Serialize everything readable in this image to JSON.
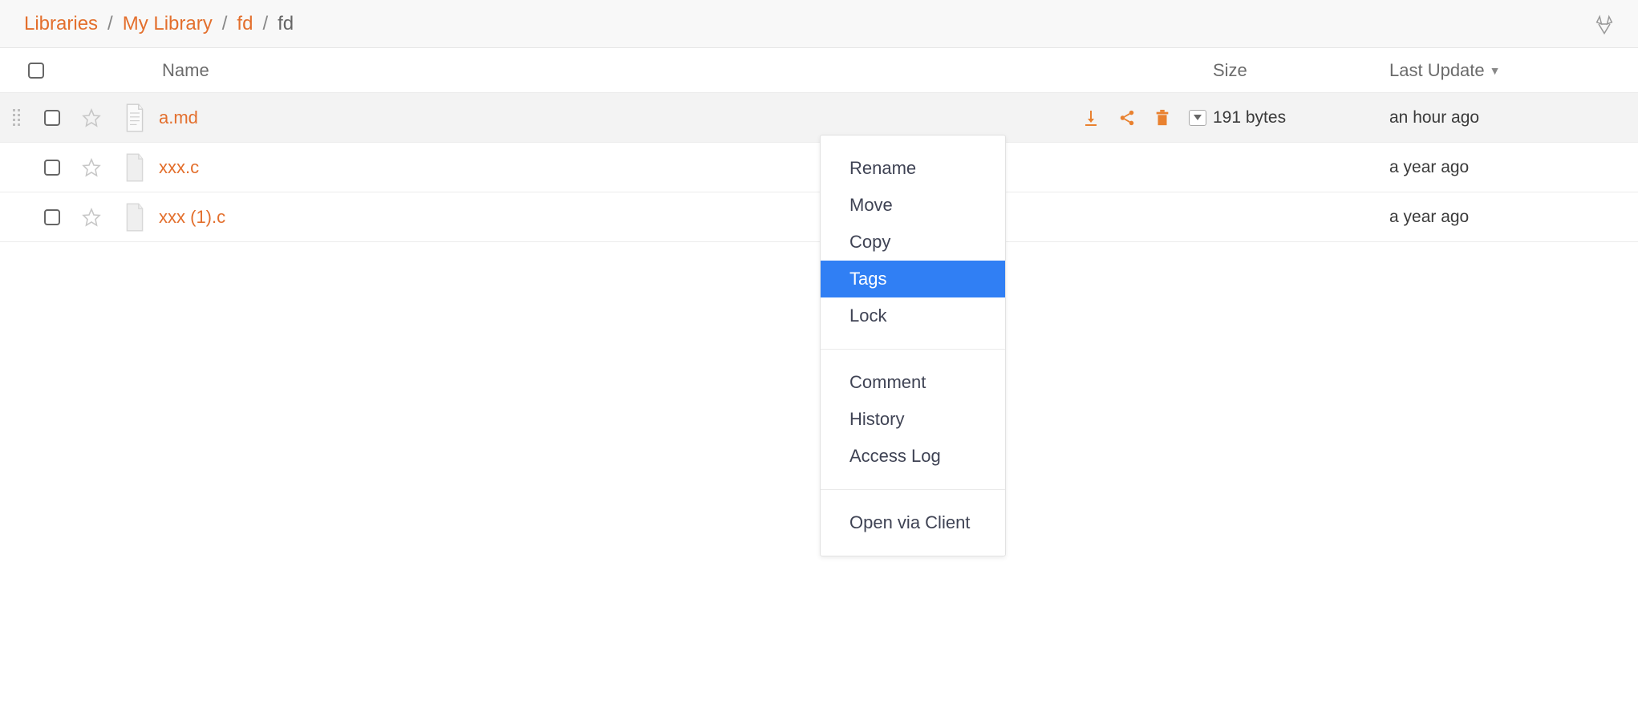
{
  "breadcrumbs": {
    "items": [
      {
        "label": "Libraries",
        "link": true
      },
      {
        "label": "My Library",
        "link": true
      },
      {
        "label": "fd",
        "link": true
      },
      {
        "label": "fd",
        "link": false
      }
    ],
    "separator": "/"
  },
  "columns": {
    "name": "Name",
    "size": "Size",
    "last_update": "Last Update"
  },
  "files": [
    {
      "name": "a.md",
      "size": "191 bytes",
      "update": "an hour ago",
      "hovered": true,
      "icon": "text"
    },
    {
      "name": "xxx.c",
      "size": "",
      "update": "a year ago",
      "hovered": false,
      "icon": "blank"
    },
    {
      "name": "xxx (1).c",
      "size": "",
      "update": "a year ago",
      "hovered": false,
      "icon": "blank"
    }
  ],
  "row_actions": {
    "download": "Download",
    "share": "Share",
    "delete": "Delete",
    "more": "More"
  },
  "context_menu": {
    "groups": [
      [
        "Rename",
        "Move",
        "Copy",
        "Tags",
        "Lock"
      ],
      [
        "Comment",
        "History",
        "Access Log"
      ],
      [
        "Open via Client"
      ]
    ],
    "highlighted": "Tags"
  },
  "colors": {
    "accent": "#e36f2d",
    "menu_highlight": "#307ff4"
  }
}
